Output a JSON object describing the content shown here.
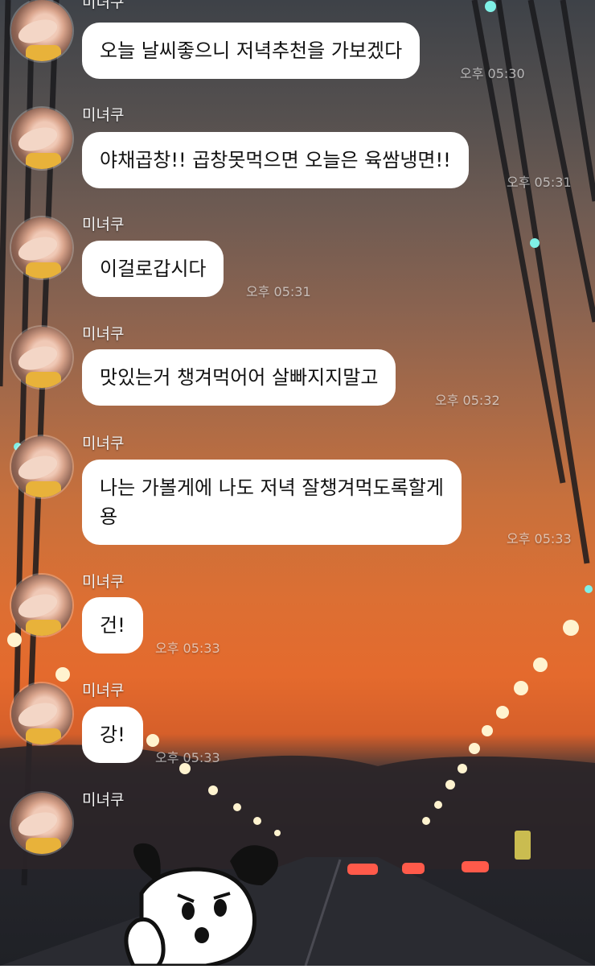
{
  "chat": {
    "sender": "미녀쿠",
    "messages": [
      {
        "text": "오늘 날씨좋으니 저녁추천을 가보겠다",
        "time": "오후 05:30"
      },
      {
        "text": "야채곱창!! 곱창못먹으면 오늘은 육쌈냉면!!",
        "time": "오후 05:31"
      },
      {
        "text": "이걸로갑시다",
        "time": "오후 05:31"
      },
      {
        "text": "맛있는거 챙겨먹어어 살빠지지말고",
        "time": "오후 05:32"
      },
      {
        "text": "나는 가볼게에 나도 저녁 잘챙겨먹도록할게",
        "text2": "용",
        "time": "오후 05:33"
      },
      {
        "text": "건!",
        "time": "오후 05:33"
      },
      {
        "text": "강!",
        "time": "오후 05:33"
      }
    ]
  },
  "sticker": {
    "icon": "puppy-sticker-icon"
  },
  "colors": {
    "bubble": "#ffffff",
    "sky_top": "#3e4248",
    "sky_sunset": "#e46a2d",
    "road": "#1f2126"
  }
}
